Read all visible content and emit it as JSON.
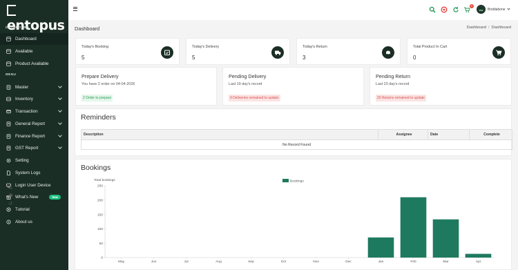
{
  "brand": {
    "logo_text": "entopus"
  },
  "sidebar": {
    "dashboard_label": "DASHBOARD",
    "menu_label": "MENU",
    "items": [
      {
        "label": "Dashboard",
        "icon": "home-icon"
      },
      {
        "label": "Available",
        "icon": "box-icon"
      },
      {
        "label": "Product Available",
        "icon": "box-icon"
      },
      {
        "label": "Master",
        "icon": "list-icon"
      },
      {
        "label": "Inventory",
        "icon": "inventory-icon"
      },
      {
        "label": "Transaction",
        "icon": "transaction-icon"
      },
      {
        "label": "General Report",
        "icon": "report-icon"
      },
      {
        "label": "Finance Report",
        "icon": "finance-icon"
      },
      {
        "label": "GST Report",
        "icon": "gst-icon"
      },
      {
        "label": "Setting",
        "icon": "gear-icon"
      },
      {
        "label": "System Logs",
        "icon": "file-icon"
      },
      {
        "label": "Login User Device",
        "icon": "device-icon"
      },
      {
        "label": "What's New",
        "icon": "gift-icon",
        "badge": "New"
      },
      {
        "label": "Tutorial",
        "icon": "play-icon"
      },
      {
        "label": "About us",
        "icon": "info-icon"
      }
    ]
  },
  "header": {
    "cart_count": "0",
    "avatar_text": "ww",
    "user_name": "Bnddabone"
  },
  "page": {
    "title": "Dashboard",
    "breadcrumb": [
      "Dashboard",
      "Dashboard"
    ]
  },
  "stats": [
    {
      "label": "Today's Booking",
      "value": "5",
      "icon": "calendar-check-icon"
    },
    {
      "label": "Today's Delivery",
      "value": "5",
      "icon": "truck-icon"
    },
    {
      "label": "Today's Return",
      "value": "3",
      "icon": "car-icon"
    },
    {
      "label": "Total Product In Cart",
      "value": "0",
      "icon": "cart-icon"
    }
  ],
  "info_cards": [
    {
      "title": "Prepare Delivery",
      "subtitle": "You have 2 order on 04-04-2026",
      "tag": "2 Order to prepare",
      "tag_color": "#2e9d5b"
    },
    {
      "title": "Pending Delivery",
      "subtitle": "Last 19 day's record",
      "tag": "9 Deliveries remained to update",
      "tag_color": "#d9534f"
    },
    {
      "title": "Pending Return",
      "subtitle": "Last 23 day's record",
      "tag": "20 Returns remained to update",
      "tag_color": "#d9534f"
    }
  ],
  "reminders": {
    "title": "Reminders",
    "columns": [
      "Description",
      "Assignee",
      "Date",
      "Complete"
    ],
    "empty_text": "No Record Found"
  },
  "bookings": {
    "title": "Bookings"
  },
  "colors": {
    "sidebar": "#1b2e26",
    "accent": "#1e7a5f",
    "green_tag": "#2e9d5b",
    "red_tag": "#d9534f"
  },
  "chart_data": {
    "type": "bar",
    "title": "Total bookings",
    "legend": "Bookings",
    "legend_position": "top-center",
    "categories": [
      "May",
      "Jun",
      "Jul",
      "Aug",
      "Sep",
      "Oct",
      "Nov",
      "Dec",
      "Jan",
      "Feb",
      "Mar",
      "Apr"
    ],
    "series": [
      {
        "name": "Bookings",
        "values": [
          0,
          0,
          0,
          0,
          0,
          0,
          0,
          0,
          70,
          210,
          133,
          13
        ]
      }
    ],
    "yticks": [
      "0",
      "50",
      "100",
      "150",
      "200",
      "250"
    ],
    "ylim": [
      0,
      250
    ],
    "grid": false,
    "bar_color": "#1e7a5f"
  }
}
